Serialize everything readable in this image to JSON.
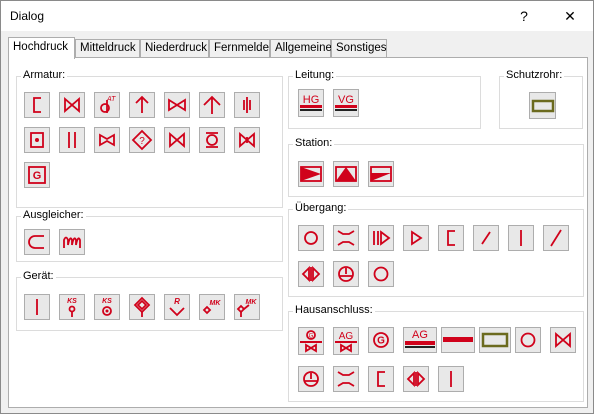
{
  "window": {
    "title": "Dialog",
    "help_label": "?",
    "close_label": "✕"
  },
  "tabs": [
    "Hochdruck",
    "Mitteldruck",
    "Niederdruck",
    "Fernmelde",
    "Allgemeine",
    "Sonstiges"
  ],
  "active_tab": "Hochdruck",
  "groups": {
    "armatur": "Armatur:",
    "ausgleicher": "Ausgleicher:",
    "geraet": "Gerät:",
    "leitung": "Leitung:",
    "schutzrohr": "Schutzrohr:",
    "station": "Station:",
    "uebergang": "Übergang:",
    "hausanschluss": "Hausanschluss:"
  },
  "symbol_text": {
    "g": "G",
    "ks": "KS",
    "r": "R",
    "mk": "MK",
    "at": "AT",
    "hg": "HG",
    "vg": "VG",
    "ag": "AG"
  },
  "colors": {
    "symbol": "#d0021b",
    "schutzrohr": "#6b6a1e",
    "button_bg": "#e8e8e8"
  }
}
